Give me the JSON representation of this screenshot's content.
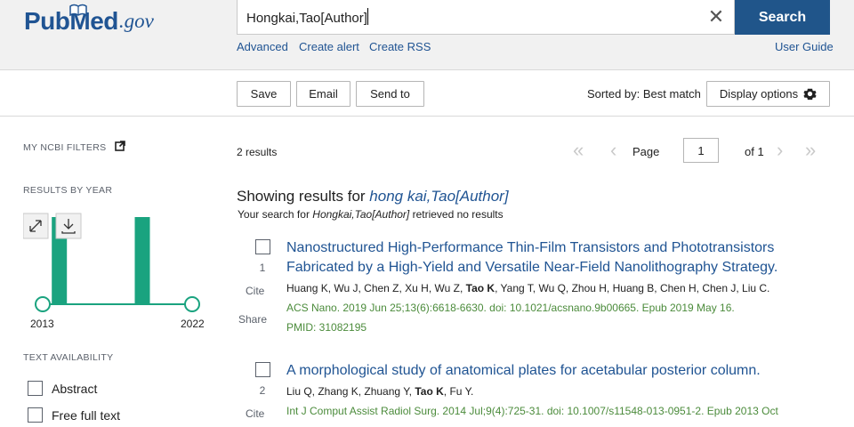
{
  "header": {
    "logo": {
      "pub": "Pub",
      "med": "Med",
      "gov": ".gov"
    },
    "search_value": "Hongkai,Tao[Author]",
    "clear_symbol": "✕",
    "search_button": "Search",
    "links": {
      "advanced": "Advanced",
      "create_alert": "Create alert",
      "create_rss": "Create RSS",
      "user_guide": "User Guide"
    }
  },
  "toolbar": {
    "save": "Save",
    "email": "Email",
    "send_to": "Send to",
    "sorted_by": "Sorted by: Best match",
    "display_options": "Display options"
  },
  "sidebar": {
    "my_filters": "MY NCBI FILTERS",
    "results_by_year": "RESULTS BY YEAR",
    "year_chart": {
      "type": "bar",
      "x_range": [
        2013,
        2022
      ],
      "bars": [
        {
          "year": 2014,
          "count": 1
        },
        {
          "year": 2019,
          "count": 1
        }
      ],
      "start_label": "2013",
      "end_label": "2022"
    },
    "text_availability": "TEXT AVAILABILITY",
    "filters": [
      {
        "label": "Abstract"
      },
      {
        "label": "Free full text"
      }
    ]
  },
  "results": {
    "count_text": "2 results",
    "pager": {
      "page_label": "Page",
      "page_value": "1",
      "of_label": "of 1"
    },
    "showing_prefix": "Showing results for ",
    "showing_query": "hong kai,Tao[Author]",
    "your_search_prefix": "Your search for ",
    "your_search_query": "Hongkai,Tao[Author]",
    "your_search_suffix": " retrieved no results",
    "articles": [
      {
        "num": "1",
        "title_line1": "Nanostructured High-Performance Thin-Film Transistors and Phototransistors",
        "title_line2": "Fabricated by a High-Yield and Versatile Near-Field Nanolithography Strategy.",
        "authors_before": "Huang K, Wu J, Chen Z, Xu H, Wu Z, ",
        "authors_bold": "Tao K",
        "authors_after": ", Yang T, Wu Q, Zhou H, Huang B, Chen H, Chen J, Liu C.",
        "citation": "ACS Nano. 2019 Jun 25;13(6):6618-6630. doi: 10.1021/acsnano.9b00665. Epub 2019 May 16.",
        "pmid": "PMID: 31082195",
        "cite": "Cite",
        "share": "Share"
      },
      {
        "num": "2",
        "title_line1": "A morphological study of anatomical plates for acetabular posterior column.",
        "authors_before": "Liu Q, Zhang K, Zhuang Y, ",
        "authors_bold": "Tao K",
        "authors_after": ", Fu Y.",
        "citation": "Int J Comput Assist Radiol Surg. 2014 Jul;9(4):725-31. doi: 10.1007/s11548-013-0951-2. Epub 2013 Oct",
        "cite": "Cite"
      }
    ]
  },
  "colors": {
    "brand": "#205493",
    "search_button": "#20558a",
    "chart_bar": "#1aa37f",
    "citation": "#4b8b3b"
  }
}
